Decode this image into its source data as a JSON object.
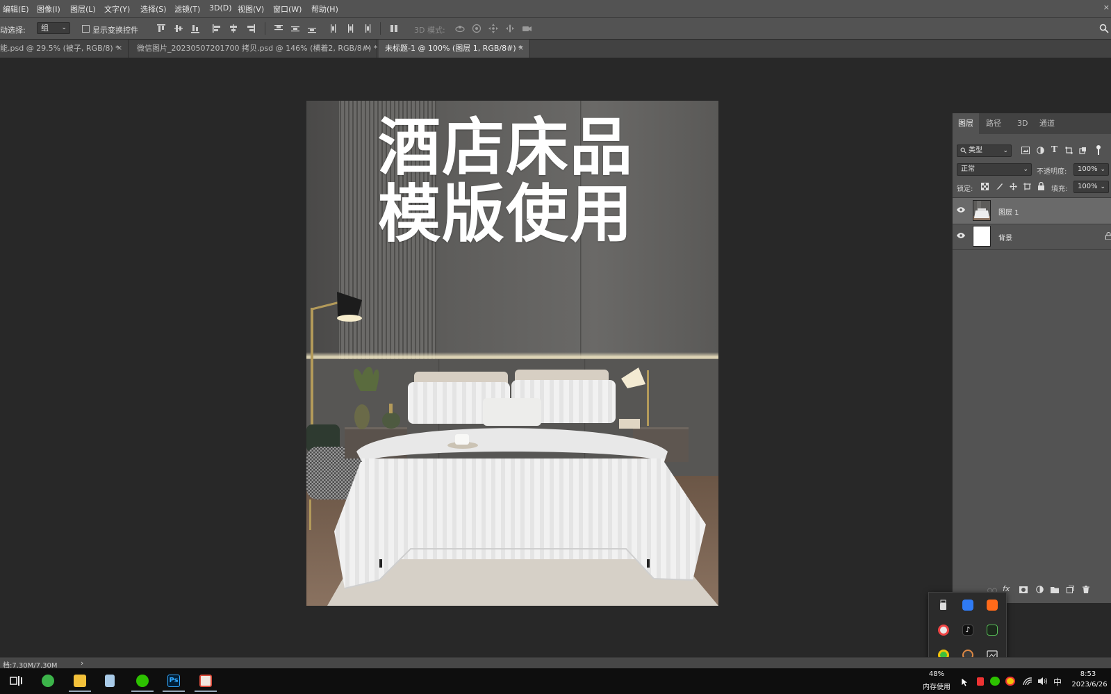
{
  "menu": {
    "items": [
      "编辑(E)",
      "图像(I)",
      "图层(L)",
      "文字(Y)",
      "选择(S)",
      "滤镜(T)",
      "3D(D)",
      "视图(V)",
      "窗口(W)",
      "帮助(H)"
    ],
    "close": "×"
  },
  "options": {
    "auto_select_label": "动选择:",
    "auto_select_value": "组",
    "show_transform_label": "显示变换控件",
    "mode_3d_label": "3D 模式:"
  },
  "tabs": [
    {
      "label": "能.psd @ 29.5% (被子, RGB/8) *",
      "close": "×"
    },
    {
      "label": "微信图片_20230507201700 拷贝.psd @ 146% (横着2, RGB/8#) *",
      "close": "×"
    },
    {
      "label": "未标题-1 @ 100% (图层 1, RGB/8#) *",
      "close": "×"
    }
  ],
  "canvas": {
    "title_line1": "酒店床品",
    "title_line2": "模版使用"
  },
  "layers_panel": {
    "tabs": [
      "图层",
      "路径",
      "3D",
      "通道"
    ],
    "filter_type": "类型",
    "blend_mode": "正常",
    "opacity_label": "不透明度:",
    "opacity_value": "100%",
    "lock_label": "锁定:",
    "fill_label": "填充:",
    "fill_value": "100%",
    "layers": [
      {
        "name": "图层 1"
      },
      {
        "name": "背景"
      }
    ]
  },
  "status": {
    "doc_size": "档:7.30M/7.30M",
    "arrow": "›"
  },
  "taskbar": {
    "memory_pct": "48%",
    "memory_label": "内存使用",
    "ime": "中",
    "time": "8:53",
    "date": "2023/6/26"
  },
  "colors": {
    "ps_bg": "#282828",
    "ps_panel": "#535353",
    "taskbar": "#0e0e0e",
    "ps_icon": "#31a8ff"
  }
}
